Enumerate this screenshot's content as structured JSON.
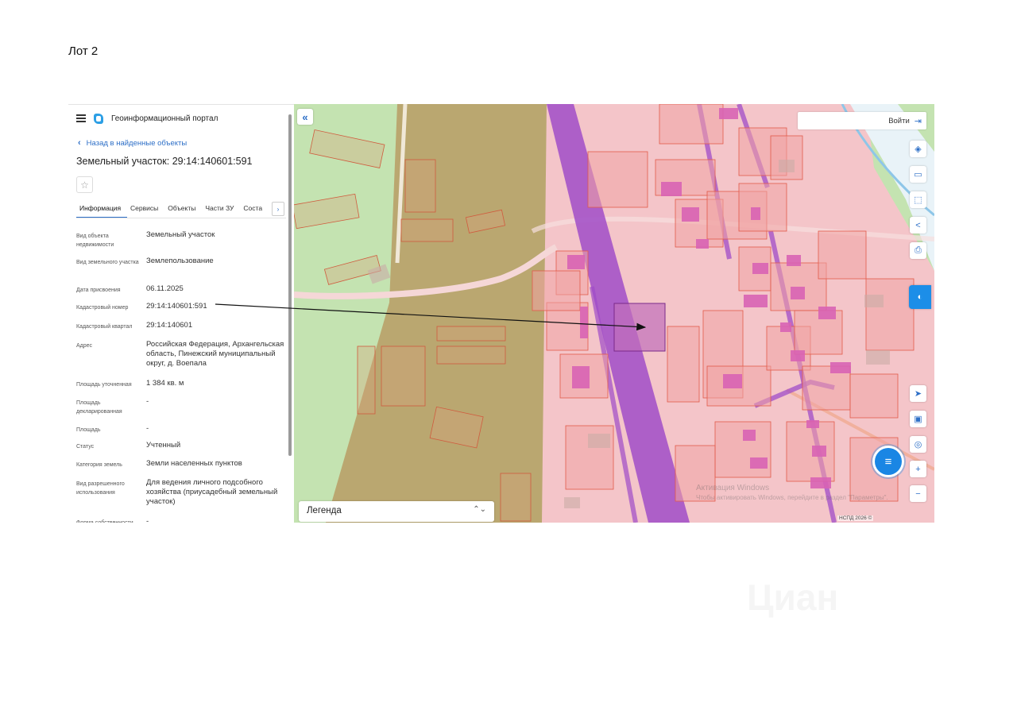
{
  "lot_title": "Лот 2",
  "header": {
    "menu_icon": "hamburger-icon",
    "logo_icon": "portal-logo-icon",
    "portal_name": "Геоинформационный портал"
  },
  "back_link": {
    "label": "Назад в найденные объекты"
  },
  "parcel_title": "Земельный участок: 29:14:140601:591",
  "star_icon": "☆",
  "tabs": [
    {
      "label": "Информация"
    },
    {
      "label": "Сервисы"
    },
    {
      "label": "Объекты"
    },
    {
      "label": "Части ЗУ"
    },
    {
      "label": "Соста"
    }
  ],
  "tab_next_label": "›",
  "properties": [
    {
      "key": "Вид объекта недвижимости",
      "value": "Земельный участок"
    },
    {
      "key": "Вид земельного участка",
      "value": "Землепользование"
    },
    {
      "key": "Дата присвоения",
      "value": "06.11.2025"
    },
    {
      "key": "Кадастровый номер",
      "value": "29:14:140601:591"
    },
    {
      "key": "Кадастровый квартал",
      "value": "29:14:140601"
    },
    {
      "key": "Адрес",
      "value": "Российская Федерация, Архангельская область, Пинежский муниципальный округ, д. Воепала"
    },
    {
      "key": "Площадь уточненная",
      "value": "1 384 кв. м"
    },
    {
      "key": "Площадь декларированная",
      "value": "-"
    },
    {
      "key": "Площадь",
      "value": "-"
    },
    {
      "key": "Статус",
      "value": "Учтенный"
    },
    {
      "key": "Категория земель",
      "value": "Земли населенных пунктов"
    },
    {
      "key": "Вид разрешенного использования",
      "value": "Для ведения личного подсобного хозяйства (приусадебный земельный участок)"
    },
    {
      "key": "Форма собственности",
      "value": "-"
    }
  ],
  "map": {
    "collapse_label": "«",
    "login_label": "Войти",
    "legend_label": "Легенда",
    "legend_arrows": "⌃⌄",
    "watermark_title": "Активация Windows",
    "watermark_sub": "Чтобы активировать Windows, перейдите в раздел \"Параметры\".",
    "footer": "НСПД 2026 ©",
    "tools": [
      {
        "name": "layers-icon",
        "glyph": "◈"
      },
      {
        "name": "ruler-icon",
        "glyph": "▭"
      },
      {
        "name": "select-area-icon",
        "glyph": "⬚"
      },
      {
        "name": "share-icon",
        "glyph": "<"
      },
      {
        "name": "print-icon",
        "glyph": "⎙"
      },
      {
        "name": "locate-icon",
        "glyph": "➤"
      },
      {
        "name": "minimap-icon",
        "glyph": "▣"
      },
      {
        "name": "geo-search-icon",
        "glyph": "◎"
      },
      {
        "name": "zoom-in-icon",
        "glyph": "+"
      },
      {
        "name": "zoom-out-icon",
        "glyph": "−"
      }
    ],
    "assistant_icon": "chat-assistant-icon",
    "fab_icon": "list-icon"
  },
  "colors": {
    "accent": "#2d6fc7",
    "pink_zone": "#f3c4c8",
    "green_zone": "#bfe1ac",
    "olive_zone": "#b8a46c",
    "purple_road": "#a34fc9",
    "highlight_parcel": "#c06fbb"
  },
  "brand_watermark": "Циан"
}
